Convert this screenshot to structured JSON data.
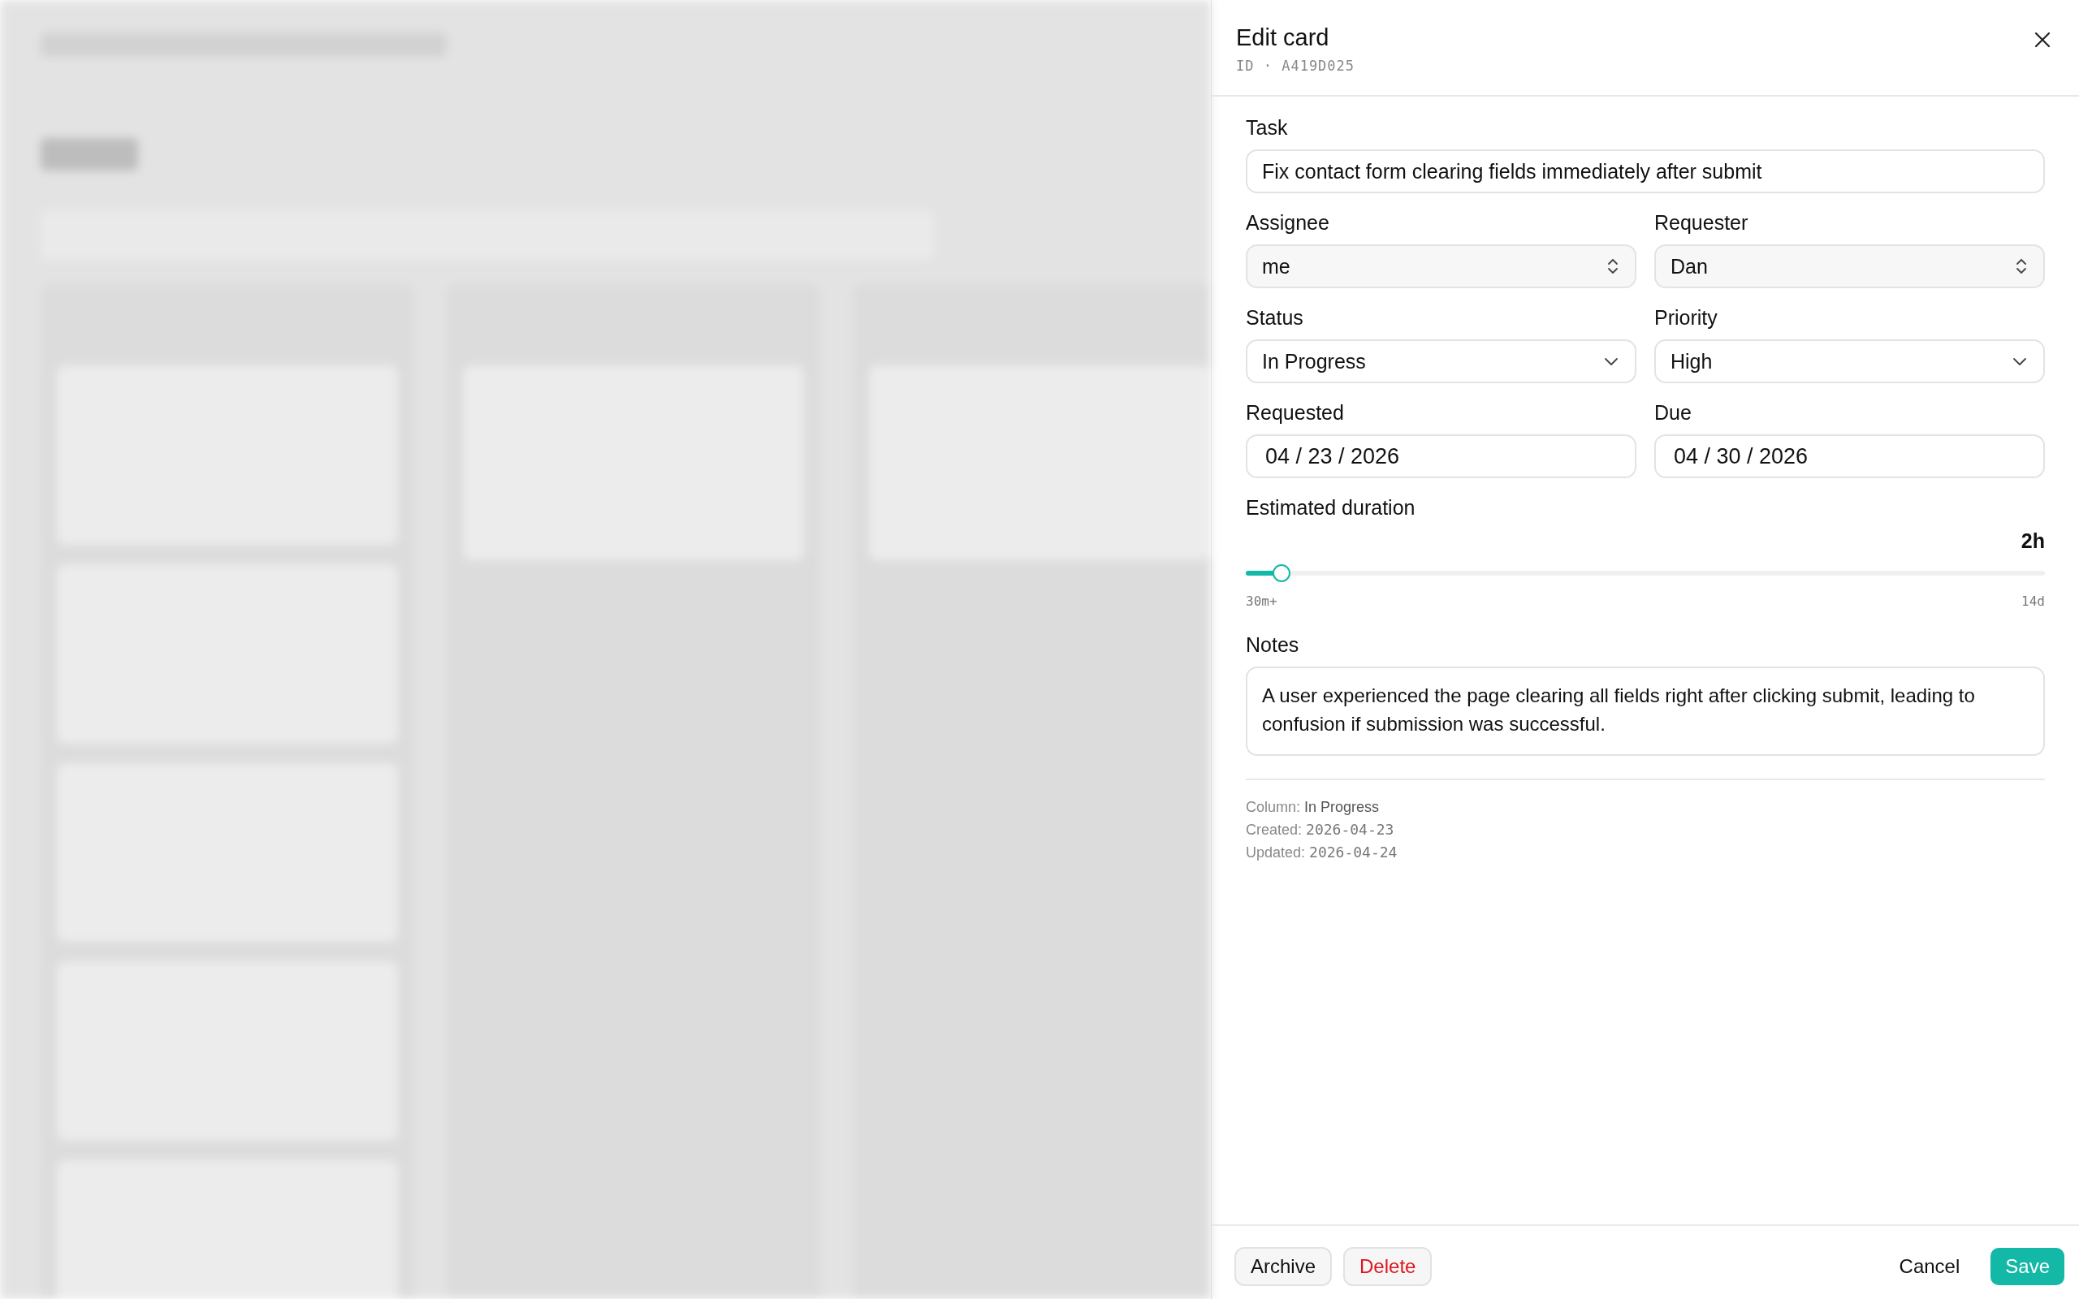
{
  "panel": {
    "title": "Edit card",
    "id_line": "ID · A419D025"
  },
  "fields": [
    {
      "kind": "text",
      "label": "Task",
      "value": "Fix contact form clearing fields immediately after submit"
    },
    {
      "kind": "stepper",
      "label": "Assignee",
      "value": "me"
    },
    {
      "kind": "stepper",
      "label": "Requester",
      "value": "Dan"
    },
    {
      "kind": "dropdown",
      "label": "Status",
      "value": "In Progress"
    },
    {
      "kind": "dropdown",
      "label": "Priority",
      "value": "High"
    },
    {
      "kind": "date",
      "label": "Requested",
      "value": "04 / 23 / 2026"
    },
    {
      "kind": "date",
      "label": "Due",
      "value": "04 / 30 / 2026"
    }
  ],
  "duration": {
    "label": "Estimated duration",
    "reading": "2h",
    "level": 0.045,
    "min_label": "30m+",
    "max_label": "14d"
  },
  "notes": {
    "label": "Notes",
    "value": "A user experienced the page clearing all fields right after clicking submit, leading to confusion if submission was successful."
  },
  "meta": [
    {
      "label": "Column: ",
      "value": "In Progress",
      "kind": "text"
    },
    {
      "label": "Created: ",
      "value": "2026-04-23",
      "kind": "mono"
    },
    {
      "label": "Updated: ",
      "value": "2026-04-24",
      "kind": "mono"
    }
  ],
  "footer": {
    "left_buttons": [
      {
        "label": "Archive",
        "kind": "neutral"
      },
      {
        "label": "Delete",
        "kind": "danger"
      }
    ],
    "cancel": "Cancel",
    "save": "Save"
  }
}
